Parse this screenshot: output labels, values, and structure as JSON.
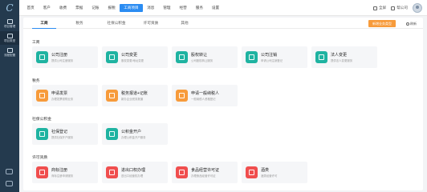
{
  "colors": {
    "accent": "#2b8cf2",
    "sidebar": "#243a4e",
    "orange": "#f79b3b",
    "teal": "#1fb3a1",
    "red": "#f04e4e"
  },
  "sidebar": {
    "logo": "C",
    "items": [
      {
        "label": "项目管理"
      },
      {
        "label": "项目类型"
      },
      {
        "label": "流程配置"
      }
    ]
  },
  "nav": {
    "items": [
      "首页",
      "客户",
      "收费",
      "票据",
      "记账",
      "报税",
      "工商项目",
      "消息",
      "管理",
      "经营",
      "服务",
      "设置"
    ],
    "active_index": 6
  },
  "top_right": {
    "fullscreen": "全屏",
    "help": "帮公司"
  },
  "tabs": {
    "items": [
      "工商",
      "税务",
      "社保公积金",
      "许可资质",
      "其他"
    ],
    "active_index": 0
  },
  "actions": {
    "primary": "新增业务类型",
    "refresh": "刷新"
  },
  "sections": [
    {
      "title": "工商",
      "cards": [
        {
          "title": "公司注册",
          "desc": "提供公司注册服务",
          "color": "teal"
        },
        {
          "title": "公司变更",
          "desc": "股权变更/地址变更",
          "color": "teal"
        },
        {
          "title": "股权转让",
          "desc": "公司股权转让服务",
          "color": "teal"
        },
        {
          "title": "公司注销",
          "desc": "申请公司注销登记",
          "color": "teal"
        },
        {
          "title": "法人变更",
          "desc": "提供法人变更服务",
          "color": "teal"
        }
      ]
    },
    {
      "title": "税务",
      "cards": [
        {
          "title": "申请发票",
          "desc": "办理发票领购业务",
          "color": "orange"
        },
        {
          "title": "税务报道+记账",
          "desc": "新办企业税务报道",
          "color": "orange"
        },
        {
          "title": "申请一般纳税人",
          "desc": "一般纳税人资格登记",
          "color": "orange"
        }
      ]
    },
    {
      "title": "社保公积金",
      "cards": [
        {
          "title": "社保登记",
          "desc": "提供社保开户服务",
          "color": "teal"
        },
        {
          "title": "公积金开户",
          "desc": "办理公积金开户服务",
          "color": "teal"
        }
      ]
    },
    {
      "title": "许可资质",
      "cards": [
        {
          "title": "商标注册",
          "desc": "商标注册申请服务",
          "color": "red"
        },
        {
          "title": "进出口权办理",
          "desc": "进出口经营权办理",
          "color": "red"
        },
        {
          "title": "食品经营许可证",
          "desc": "办理食品经营许可证",
          "color": "red"
        },
        {
          "title": "酒类",
          "desc": "酒类经营许可",
          "color": "red"
        }
      ]
    }
  ]
}
